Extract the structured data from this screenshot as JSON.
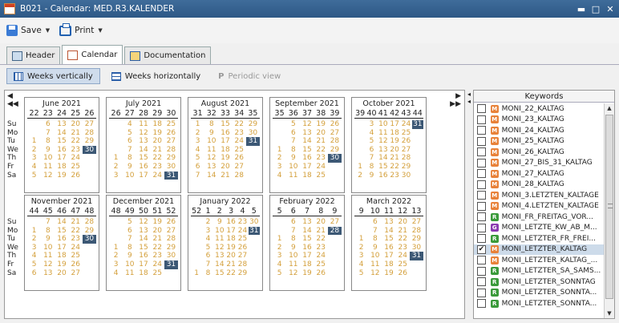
{
  "window": {
    "title": "B021 - Calendar: MED.R3.KALENDER",
    "min_icon": "minimize-icon",
    "max_icon": "maximize-icon",
    "close_icon": "close-icon"
  },
  "toolbar": {
    "save_label": "Save",
    "print_label": "Print"
  },
  "tabs": [
    {
      "label": "Header",
      "icon": "header-icon"
    },
    {
      "label": "Calendar",
      "icon": "calendar-icon"
    },
    {
      "label": "Documentation",
      "icon": "documentation-icon"
    }
  ],
  "views": {
    "vertical": "Weeks vertically",
    "horizontal": "Weeks horizontally",
    "periodic": "Periodic view",
    "periodic_glyph": "P"
  },
  "day_labels": [
    "Su",
    "Mo",
    "Tu",
    "We",
    "Th",
    "Fr",
    "Sa"
  ],
  "months": [
    {
      "name": "June 2021",
      "weeks": [
        "22",
        "23",
        "24",
        "25",
        "26"
      ],
      "days": [
        [
          "",
          "6",
          "13",
          "20",
          "27"
        ],
        [
          "",
          "7",
          "14",
          "21",
          "28"
        ],
        [
          "1",
          "8",
          "15",
          "22",
          "29"
        ],
        [
          "2",
          "9",
          "16",
          "23",
          "30"
        ],
        [
          "3",
          "10",
          "17",
          "24",
          ""
        ],
        [
          "4",
          "11",
          "18",
          "25",
          ""
        ],
        [
          "5",
          "12",
          "19",
          "26",
          ""
        ]
      ],
      "selected": [
        "30"
      ]
    },
    {
      "name": "July 2021",
      "weeks": [
        "26",
        "27",
        "28",
        "29",
        "30"
      ],
      "days": [
        [
          "",
          "4",
          "11",
          "18",
          "25"
        ],
        [
          "",
          "5",
          "12",
          "19",
          "26"
        ],
        [
          "",
          "6",
          "13",
          "20",
          "27"
        ],
        [
          "",
          "7",
          "14",
          "21",
          "28"
        ],
        [
          "1",
          "8",
          "15",
          "22",
          "29"
        ],
        [
          "2",
          "9",
          "16",
          "23",
          "30"
        ],
        [
          "3",
          "10",
          "17",
          "24",
          "31"
        ]
      ],
      "selected": [
        "31"
      ]
    },
    {
      "name": "August 2021",
      "weeks": [
        "31",
        "32",
        "33",
        "34",
        "35"
      ],
      "days": [
        [
          "1",
          "8",
          "15",
          "22",
          "29"
        ],
        [
          "2",
          "9",
          "16",
          "23",
          "30"
        ],
        [
          "3",
          "10",
          "17",
          "24",
          "31"
        ],
        [
          "4",
          "11",
          "18",
          "25",
          ""
        ],
        [
          "5",
          "12",
          "19",
          "26",
          ""
        ],
        [
          "6",
          "13",
          "20",
          "27",
          ""
        ],
        [
          "7",
          "14",
          "21",
          "28",
          ""
        ]
      ],
      "selected": [
        "31"
      ]
    },
    {
      "name": "September 2021",
      "weeks": [
        "35",
        "36",
        "37",
        "38",
        "39"
      ],
      "days": [
        [
          "",
          "5",
          "12",
          "19",
          "26"
        ],
        [
          "",
          "6",
          "13",
          "20",
          "27"
        ],
        [
          "",
          "7",
          "14",
          "21",
          "28"
        ],
        [
          "1",
          "8",
          "15",
          "22",
          "29"
        ],
        [
          "2",
          "9",
          "16",
          "23",
          "30"
        ],
        [
          "3",
          "10",
          "17",
          "24",
          ""
        ],
        [
          "4",
          "11",
          "18",
          "25",
          ""
        ]
      ],
      "selected": [
        "30"
      ]
    },
    {
      "name": "October 2021",
      "weeks": [
        "39",
        "40",
        "41",
        "42",
        "43",
        "44"
      ],
      "days": [
        [
          "",
          "3",
          "10",
          "17",
          "24",
          "31"
        ],
        [
          "",
          "4",
          "11",
          "18",
          "25",
          ""
        ],
        [
          "",
          "5",
          "12",
          "19",
          "26",
          ""
        ],
        [
          "",
          "6",
          "13",
          "20",
          "27",
          ""
        ],
        [
          "",
          "7",
          "14",
          "21",
          "28",
          ""
        ],
        [
          "1",
          "8",
          "15",
          "22",
          "29",
          ""
        ],
        [
          "2",
          "9",
          "16",
          "23",
          "30",
          ""
        ]
      ],
      "selected": [
        "31"
      ]
    },
    {
      "name": "November 2021",
      "weeks": [
        "44",
        "45",
        "46",
        "47",
        "48"
      ],
      "days": [
        [
          "",
          "7",
          "14",
          "21",
          "28"
        ],
        [
          "1",
          "8",
          "15",
          "22",
          "29"
        ],
        [
          "2",
          "9",
          "16",
          "23",
          "30"
        ],
        [
          "3",
          "10",
          "17",
          "24",
          ""
        ],
        [
          "4",
          "11",
          "18",
          "25",
          ""
        ],
        [
          "5",
          "12",
          "19",
          "26",
          ""
        ],
        [
          "6",
          "13",
          "20",
          "27",
          ""
        ]
      ],
      "selected": [
        "30"
      ]
    },
    {
      "name": "December 2021",
      "weeks": [
        "48",
        "49",
        "50",
        "51",
        "52"
      ],
      "days": [
        [
          "",
          "5",
          "12",
          "19",
          "26"
        ],
        [
          "",
          "6",
          "13",
          "20",
          "27"
        ],
        [
          "",
          "7",
          "14",
          "21",
          "28"
        ],
        [
          "1",
          "8",
          "15",
          "22",
          "29"
        ],
        [
          "2",
          "9",
          "16",
          "23",
          "30"
        ],
        [
          "3",
          "10",
          "17",
          "24",
          "31"
        ],
        [
          "4",
          "11",
          "18",
          "25",
          ""
        ]
      ],
      "selected": [
        "31"
      ]
    },
    {
      "name": "January 2022",
      "weeks": [
        "52",
        "1",
        "2",
        "3",
        "4",
        "5"
      ],
      "days": [
        [
          "",
          "2",
          "9",
          "16",
          "23",
          "30"
        ],
        [
          "",
          "3",
          "10",
          "17",
          "24",
          "31"
        ],
        [
          "",
          "4",
          "11",
          "18",
          "25",
          ""
        ],
        [
          "",
          "5",
          "12",
          "19",
          "26",
          ""
        ],
        [
          "",
          "6",
          "13",
          "20",
          "27",
          ""
        ],
        [
          "",
          "7",
          "14",
          "21",
          "28",
          ""
        ],
        [
          "1",
          "8",
          "15",
          "22",
          "29",
          ""
        ]
      ],
      "selected": [
        "31"
      ]
    },
    {
      "name": "February 2022",
      "weeks": [
        "5",
        "6",
        "7",
        "8",
        "9"
      ],
      "days": [
        [
          "",
          "6",
          "13",
          "20",
          "27"
        ],
        [
          "",
          "7",
          "14",
          "21",
          "28"
        ],
        [
          "1",
          "8",
          "15",
          "22",
          ""
        ],
        [
          "2",
          "9",
          "16",
          "23",
          ""
        ],
        [
          "3",
          "10",
          "17",
          "24",
          ""
        ],
        [
          "4",
          "11",
          "18",
          "25",
          ""
        ],
        [
          "5",
          "12",
          "19",
          "26",
          ""
        ]
      ],
      "selected": [
        "28"
      ]
    },
    {
      "name": "March 2022",
      "weeks": [
        "9",
        "10",
        "11",
        "12",
        "13"
      ],
      "days": [
        [
          "",
          "6",
          "13",
          "20",
          "27"
        ],
        [
          "",
          "7",
          "14",
          "21",
          "28"
        ],
        [
          "1",
          "8",
          "15",
          "22",
          "29"
        ],
        [
          "2",
          "9",
          "16",
          "23",
          "30"
        ],
        [
          "3",
          "10",
          "17",
          "24",
          "31"
        ],
        [
          "4",
          "11",
          "18",
          "25",
          ""
        ],
        [
          "5",
          "12",
          "19",
          "26",
          ""
        ]
      ],
      "selected": [
        "31"
      ]
    }
  ],
  "keywords": {
    "header": "Keywords",
    "items": [
      {
        "label": "MONI_22_KALTAG",
        "color": "#e8823a",
        "letter": "M",
        "checked": false
      },
      {
        "label": "MONI_23_KALTAG",
        "color": "#e8823a",
        "letter": "M",
        "checked": false
      },
      {
        "label": "MONI_24_KALTAG",
        "color": "#e8823a",
        "letter": "M",
        "checked": false
      },
      {
        "label": "MONI_25_KALTAG",
        "color": "#e8823a",
        "letter": "M",
        "checked": false
      },
      {
        "label": "MONI_26_KALTAG",
        "color": "#e8823a",
        "letter": "M",
        "checked": false
      },
      {
        "label": "MONI_27_BIS_31_KALTAG",
        "color": "#e8823a",
        "letter": "M",
        "checked": false
      },
      {
        "label": "MONI_27_KALTAG",
        "color": "#e8823a",
        "letter": "M",
        "checked": false
      },
      {
        "label": "MONI_28_KALTAG",
        "color": "#e8823a",
        "letter": "M",
        "checked": false
      },
      {
        "label": "MONI_3.LETZTEN_KALTAGE",
        "color": "#e8823a",
        "letter": "M",
        "checked": false
      },
      {
        "label": "MONI_4.LETZTEN_KALTAGE",
        "color": "#e8823a",
        "letter": "M",
        "checked": false
      },
      {
        "label": "MONI_FR_FREITAG_VOR...",
        "color": "#3a9a3a",
        "letter": "R",
        "checked": false
      },
      {
        "label": "MONI_LETZTE_KW_AB_M...",
        "color": "#8a3ab0",
        "letter": "G",
        "checked": false
      },
      {
        "label": "MONI_LETZTER_FR_FREI...",
        "color": "#3a9a3a",
        "letter": "R",
        "checked": false
      },
      {
        "label": "MONI_LETZTER_KALTAG",
        "color": "#e8823a",
        "letter": "M",
        "checked": true
      },
      {
        "label": "MONI_LETZTER_KALTAG_...",
        "color": "#e8823a",
        "letter": "M",
        "checked": false
      },
      {
        "label": "MONI_LETZTER_SA_SAMS...",
        "color": "#3a9a3a",
        "letter": "R",
        "checked": false
      },
      {
        "label": "MONI_LETZTER_SONNTAG",
        "color": "#3a9a3a",
        "letter": "R",
        "checked": false
      },
      {
        "label": "MONI_LETZTER_SONNTA...",
        "color": "#3a9a3a",
        "letter": "R",
        "checked": false
      },
      {
        "label": "MONI_LETZTER_SONNTA...",
        "color": "#3a9a3a",
        "letter": "R",
        "checked": false
      }
    ]
  }
}
